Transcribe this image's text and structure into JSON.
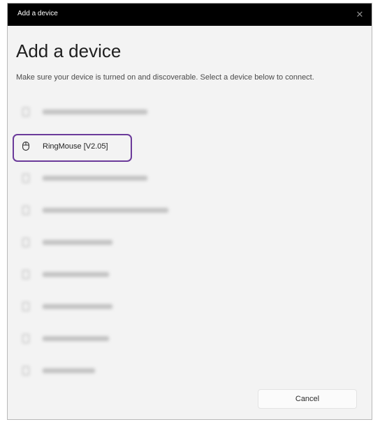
{
  "window": {
    "title": "Add a device",
    "close_glyph": "✕"
  },
  "page": {
    "heading": "Add a device",
    "instructions": "Make sure your device is turned on and discoverable. Select a device below to connect."
  },
  "devices": [
    {
      "label": "",
      "icon": "bluetooth-device-icon",
      "blurred": true
    },
    {
      "label": "RingMouse [V2.05]",
      "icon": "mouse-icon",
      "blurred": false,
      "selected": true
    },
    {
      "label": "",
      "icon": "bluetooth-device-icon",
      "blurred": true
    },
    {
      "label": "",
      "icon": "bluetooth-device-icon",
      "blurred": true
    },
    {
      "label": "",
      "icon": "bluetooth-device-icon",
      "blurred": true
    },
    {
      "label": "",
      "icon": "bluetooth-device-icon",
      "blurred": true
    },
    {
      "label": "",
      "icon": "bluetooth-device-icon",
      "blurred": true
    },
    {
      "label": "",
      "icon": "bluetooth-device-icon",
      "blurred": true
    },
    {
      "label": "",
      "icon": "bluetooth-device-icon",
      "blurred": true
    }
  ],
  "footer": {
    "cancel_label": "Cancel"
  },
  "colors": {
    "selection_outline": "#6b3a9a",
    "titlebar": "#000000",
    "window_bg": "#f3f3f3"
  }
}
